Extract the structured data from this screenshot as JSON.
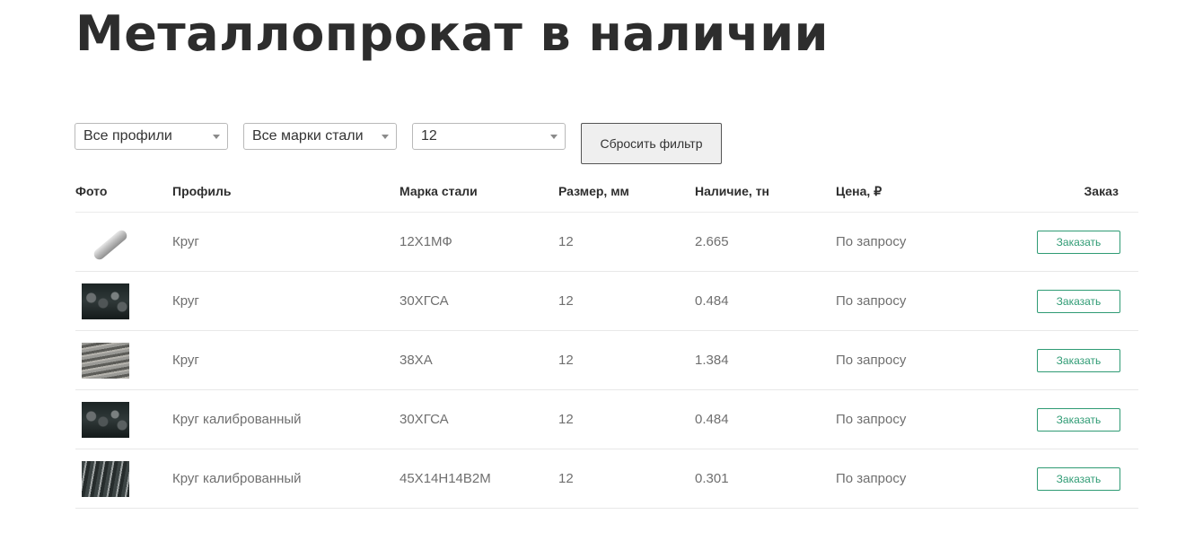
{
  "page": {
    "title": "Металлопрокат в наличии"
  },
  "filters": {
    "profile": "Все профили",
    "grade": "Все марки стали",
    "size": "12",
    "reset_label": "Сбросить фильтр"
  },
  "table": {
    "headers": {
      "photo": "Фото",
      "profile": "Профиль",
      "grade": "Марка стали",
      "size": "Размер, мм",
      "stock": "Наличие, тн",
      "price": "Цена, ₽",
      "order": "Заказ"
    },
    "rows": [
      {
        "profile": "Круг",
        "grade": "12Х1МФ",
        "size": "12",
        "stock": "2.665",
        "price": "По запросу",
        "order": "Заказать"
      },
      {
        "profile": "Круг",
        "grade": "30ХГСА",
        "size": "12",
        "stock": "0.484",
        "price": "По запросу",
        "order": "Заказать"
      },
      {
        "profile": "Круг",
        "grade": "38ХА",
        "size": "12",
        "stock": "1.384",
        "price": "По запросу",
        "order": "Заказать"
      },
      {
        "profile": "Круг калиброванный",
        "grade": "30ХГСА",
        "size": "12",
        "stock": "0.484",
        "price": "По запросу",
        "order": "Заказать"
      },
      {
        "profile": "Круг калиброванный",
        "grade": "45Х14Н14В2М",
        "size": "12",
        "stock": "0.301",
        "price": "По запросу",
        "order": "Заказать"
      }
    ]
  },
  "colors": {
    "accent": "#2f9b74",
    "heading": "#2d2d2d",
    "muted": "#6f6f6f"
  }
}
